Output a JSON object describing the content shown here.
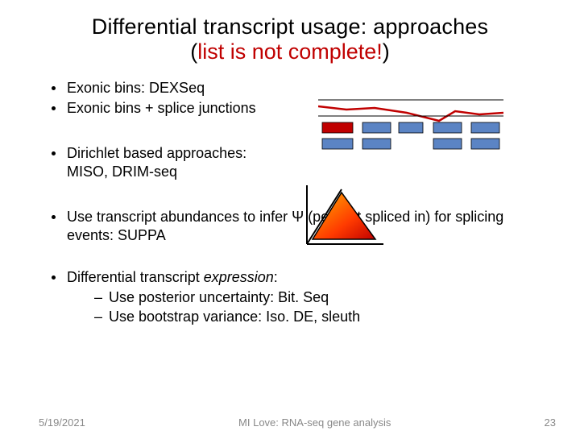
{
  "title": {
    "line1": "Differential transcript usage: approaches",
    "paren_open": "(",
    "red_text": "list is not complete!",
    "paren_close": ")"
  },
  "bullets": {
    "b1": "Exonic bins: DEXSeq",
    "b2": "Exonic bins + splice junctions",
    "b3": "Dirichlet based approaches: MISO, DRIM-seq",
    "b4": "Use transcript abundances to infer Ψ (percent spliced in) for splicing events: SUPPA",
    "b5_prefix": "Differential transcript ",
    "b5_italic": "expression",
    "b5_suffix": ":",
    "s1": "Use posterior uncertainty: Bit. Seq",
    "s2": "Use bootstrap variance: Iso. DE, sleuth"
  },
  "footer": {
    "date": "5/19/2021",
    "center": "MI Love: RNA-seq gene analysis",
    "page": "23"
  }
}
